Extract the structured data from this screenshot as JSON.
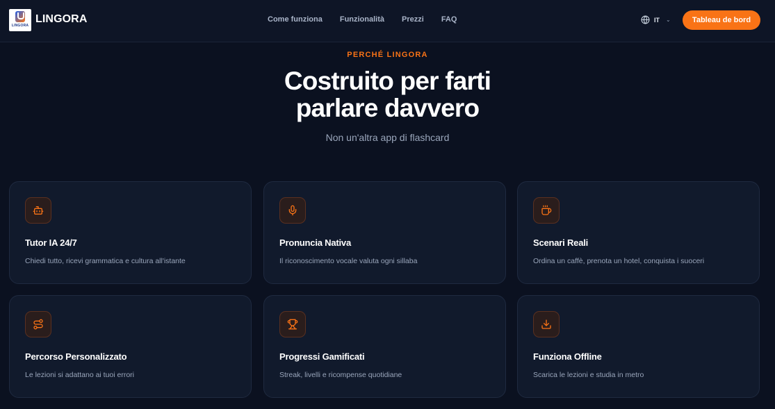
{
  "header": {
    "logo_text": "LINGORA",
    "brand": "LINGORA",
    "nav": [
      "Come funziona",
      "Funzionalità",
      "Prezzi",
      "FAQ"
    ],
    "language": "IT",
    "cta": "Tableau de bord"
  },
  "hero": {
    "eyebrow": "PERCHÉ LINGORA",
    "title_line1": "Costruito per farti",
    "title_line2": "parlare davvero",
    "subtitle": "Non un'altra app di flashcard"
  },
  "features": [
    {
      "icon": "bot-icon",
      "title": "Tutor IA 24/7",
      "desc": "Chiedi tutto, ricevi grammatica e cultura all'istante"
    },
    {
      "icon": "microphone-icon",
      "title": "Pronuncia Nativa",
      "desc": "Il riconoscimento vocale valuta ogni sillaba"
    },
    {
      "icon": "coffee-icon",
      "title": "Scenari Reali",
      "desc": "Ordina un caffè, prenota un hotel, conquista i suoceri"
    },
    {
      "icon": "route-icon",
      "title": "Percorso Personalizzato",
      "desc": "Le lezioni si adattano ai tuoi errori"
    },
    {
      "icon": "trophy-icon",
      "title": "Progressi Gamificati",
      "desc": "Streak, livelli e ricompense quotidiane"
    },
    {
      "icon": "download-icon",
      "title": "Funziona Offline",
      "desc": "Scarica le lezioni e studia in metro"
    }
  ],
  "colors": {
    "accent": "#f97316",
    "background": "#0b1120",
    "card": "#111a2c"
  }
}
